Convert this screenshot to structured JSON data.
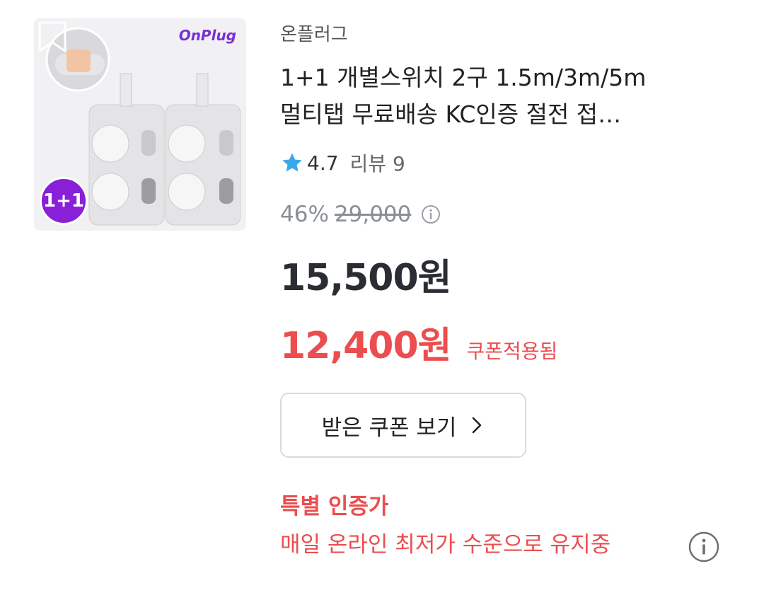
{
  "product": {
    "brand": "온플러그",
    "title_line1": "1+1 개별스위치 2구 1.5m/3m/5m",
    "title_line2": "멀티탭 무료배송 KC인증 절전 접…",
    "rating": "4.7",
    "reviews": "리뷰 9",
    "discount_pct": "46%",
    "original_price": "29,000",
    "price": "15,500원",
    "coupon_price": "12,400원",
    "coupon_label": "쿠폰적용됨",
    "coupon_button_label": "받은 쿠폰 보기",
    "special_title": "특별 인증가",
    "special_desc": "매일 온라인 최저가 수준으로 유지중"
  },
  "image": {
    "logo_text": "OnPlug",
    "badge_text": "1+1"
  },
  "colors": {
    "accent_red": "#ec4d4f",
    "star_blue": "#3aa7e8",
    "badge_purple": "#8a1fd8"
  },
  "icons": [
    "star-icon",
    "info-icon",
    "chevron-right-icon",
    "bookmark-icon"
  ]
}
